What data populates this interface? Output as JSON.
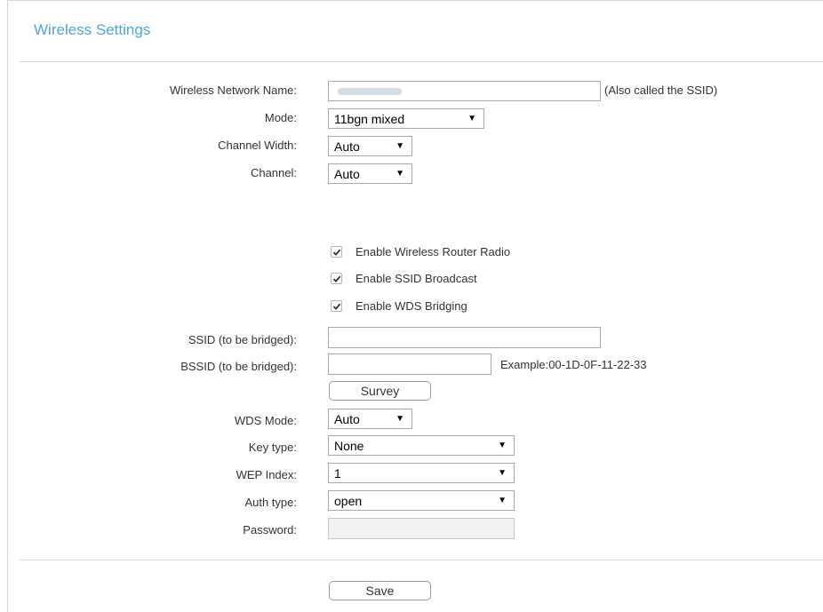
{
  "page": {
    "title": "Wireless Settings"
  },
  "form": {
    "wireless_network_name": {
      "label": "Wireless Network Name:",
      "hint": "(Also called the SSID)"
    },
    "mode": {
      "label": "Mode:",
      "value": "11bgn mixed"
    },
    "channel_width": {
      "label": "Channel Width:",
      "value": "Auto"
    },
    "channel": {
      "label": "Channel:",
      "value": "Auto"
    },
    "checkboxes": {
      "radio": {
        "label": "Enable Wireless Router Radio",
        "checked": true
      },
      "ssid_broadcast": {
        "label": "Enable SSID Broadcast",
        "checked": true
      },
      "wds_bridging": {
        "label": "Enable WDS Bridging",
        "checked": true
      }
    },
    "ssid_bridged": {
      "label": "SSID (to be bridged):",
      "value": ""
    },
    "bssid_bridged": {
      "label": "BSSID (to be bridged):",
      "value": "",
      "hint": "Example:00-1D-0F-11-22-33"
    },
    "survey_button": "Survey",
    "wds_mode": {
      "label": "WDS Mode:",
      "value": "Auto"
    },
    "key_type": {
      "label": "Key type:",
      "value": "None"
    },
    "wep_index": {
      "label": "WEP Index:",
      "value": "1"
    },
    "auth_type": {
      "label": "Auth type:",
      "value": "open"
    },
    "password": {
      "label": "Password:",
      "value": ""
    },
    "save_button": "Save"
  },
  "icons": {
    "dropdown": "dropdown-arrow-icon",
    "check": "checkmark-icon"
  }
}
